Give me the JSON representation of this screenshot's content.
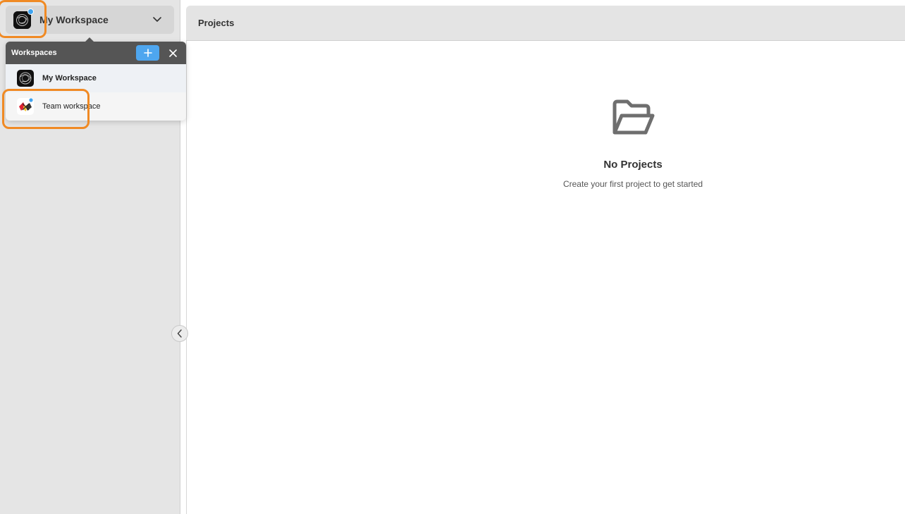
{
  "sidebar": {
    "workspace_switcher": {
      "name": "My Workspace",
      "avatar_icon": "workspace-logo-icon",
      "chevron_icon": "chevron-down-icon"
    },
    "collapse_icon": "chevron-left-icon"
  },
  "main": {
    "header_title": "Projects",
    "empty_state": {
      "icon": "folder-open-icon",
      "title": "No Projects",
      "subtitle": "Create your first project to get started"
    }
  },
  "workspaces_popover": {
    "title": "Workspaces",
    "add_icon": "plus-icon",
    "close_icon": "close-icon",
    "items": [
      {
        "label": "My Workspace",
        "selected": true,
        "avatar_icon": "workspace-logo-icon"
      },
      {
        "label": "Team workspace",
        "selected": false,
        "avatar_icon": "team-logo-icon"
      }
    ]
  },
  "colors": {
    "accent": "#4ea6ef",
    "highlight": "#f08a24",
    "sidebar_bg": "#e5e5e5",
    "popover_header": "#555555"
  }
}
